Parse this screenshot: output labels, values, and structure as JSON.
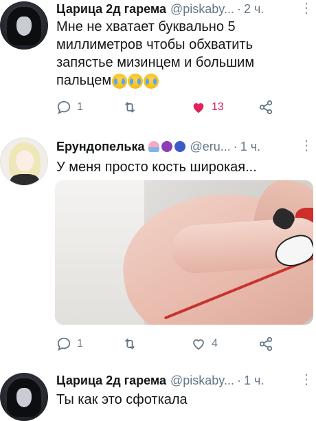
{
  "tweets": [
    {
      "name": "Царица 2д гарема",
      "handle": "@piskaby...",
      "sep": "·",
      "time": "2 ч.",
      "text": "Мне не хватает буквально 5 миллиметров чтобы обхватить запястье мизинцем и большим пальцем",
      "emoji": [
        "crying-face",
        "crying-face",
        "crying-face"
      ],
      "replies": "1",
      "retweets": "",
      "likes": "13",
      "liked": true
    },
    {
      "name": "Ерундопелька",
      "badges": [
        "cupcake",
        "grapes",
        "blueberries"
      ],
      "handle": "@eru...",
      "sep": "·",
      "time": "1 ч.",
      "text": "У меня просто кость широкая...",
      "replies": "1",
      "retweets": "",
      "likes": "4",
      "liked": false
    },
    {
      "name": "Царица 2д гарема",
      "handle": "@piskaby...",
      "sep": "·",
      "time": "1 ч.",
      "text": "Ты как это сфоткала"
    }
  ],
  "colors": {
    "like_active": "#e0245e",
    "muted": "#657786",
    "text": "#14171a"
  }
}
